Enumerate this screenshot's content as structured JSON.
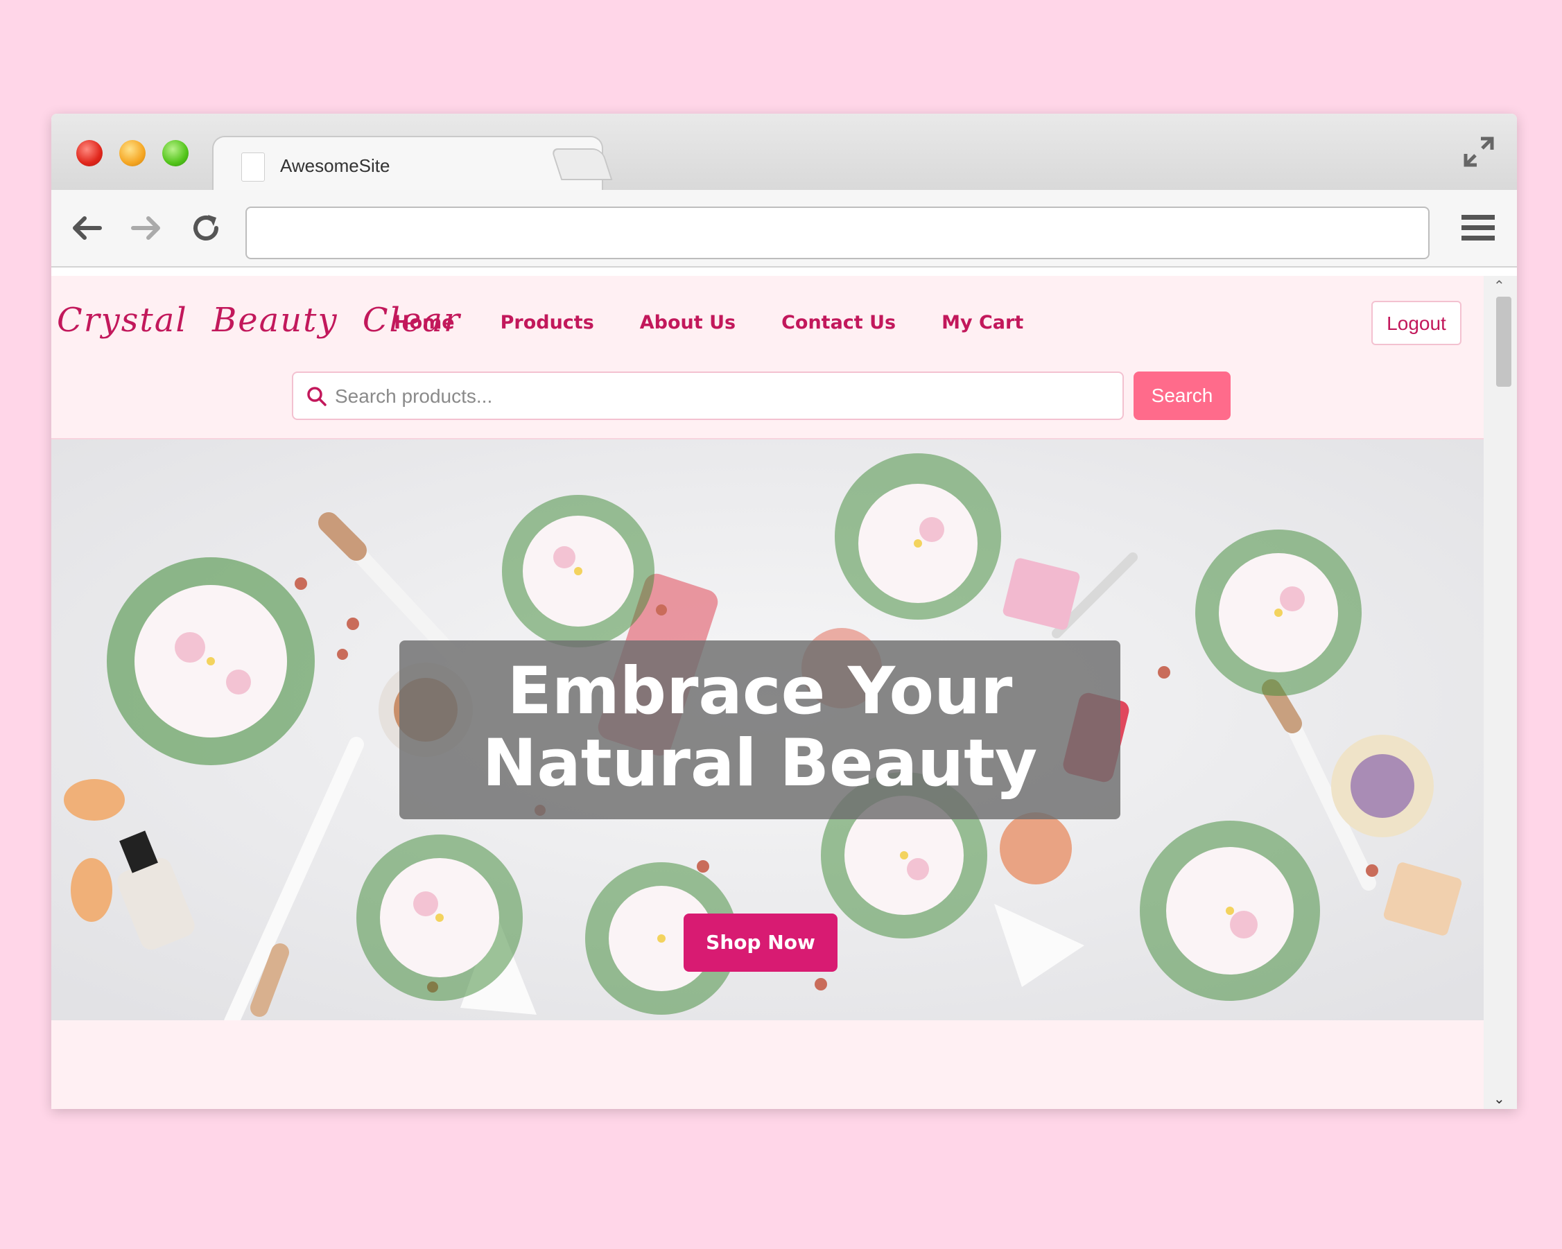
{
  "browser": {
    "tab_title": "AwesomeSite",
    "tab_close": "×",
    "url": ""
  },
  "site": {
    "logo": "Crystal Beauty Clear",
    "nav": [
      {
        "label": "Home"
      },
      {
        "label": "Products"
      },
      {
        "label": "About Us"
      },
      {
        "label": "Contact Us"
      },
      {
        "label": "My Cart"
      }
    ],
    "logout_label": "Logout",
    "search": {
      "placeholder": "Search products...",
      "button_label": "Search"
    }
  },
  "hero": {
    "title_line1": "Embrace Your",
    "title_line2": "Natural Beauty",
    "cta_label": "Shop Now"
  },
  "colors": {
    "page_background": "#ffd6e8",
    "brand": "#c2185b",
    "search_button": "#ff6b8b",
    "cta_button": "#d81b72"
  },
  "icons": {
    "back": "arrow-left-icon",
    "forward": "arrow-right-icon",
    "reload": "reload-icon",
    "menu": "hamburger-menu-icon",
    "expand": "expand-icon",
    "search": "search-icon"
  }
}
